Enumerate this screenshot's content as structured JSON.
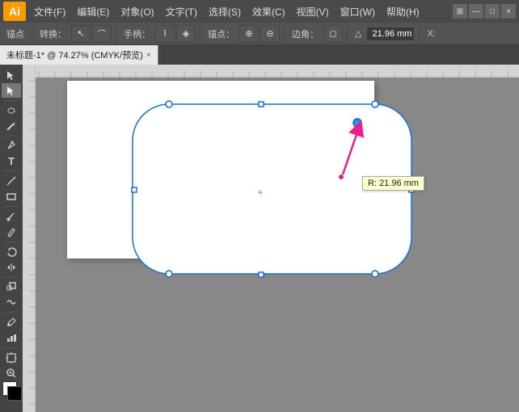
{
  "titlebar": {
    "logo": "Ai",
    "menus": [
      "文件(F)",
      "编辑(E)",
      "对象(O)",
      "文字(T)",
      "选择(S)",
      "效果(C)",
      "视图(V)",
      "窗口(W)",
      "帮助(H)"
    ],
    "win_controls": [
      "□",
      "—",
      "×"
    ]
  },
  "toolbar1": {
    "label1": "锚点",
    "label2": "转换：",
    "label3": "手柄：",
    "label4": "锚点：",
    "label5": "边角：",
    "angle_label": "△",
    "angle_value": "21.96 mm",
    "x_label": "X:",
    "grid_icon": "⊞"
  },
  "tabs": [
    {
      "label": "未标题-1* @ 74.27% (CMYK/预览)",
      "active": true
    }
  ],
  "tools": [
    {
      "icon": "↖",
      "name": "select"
    },
    {
      "icon": "⊹",
      "name": "direct-select"
    },
    {
      "icon": "⬡",
      "name": "lasso"
    },
    {
      "icon": "✒",
      "name": "pen"
    },
    {
      "icon": "T",
      "name": "type"
    },
    {
      "icon": "∕",
      "name": "line"
    },
    {
      "icon": "□",
      "name": "rectangle"
    },
    {
      "icon": "◉",
      "name": "paintbrush"
    },
    {
      "icon": "✏",
      "name": "pencil"
    },
    {
      "icon": "◈",
      "name": "rotate"
    },
    {
      "icon": "⟲",
      "name": "mirror"
    },
    {
      "icon": "◱",
      "name": "scale"
    },
    {
      "icon": "≋",
      "name": "warp"
    },
    {
      "icon": "⬛",
      "name": "width"
    },
    {
      "icon": "⊡",
      "name": "symbol-spray"
    },
    {
      "icon": "📊",
      "name": "graph"
    },
    {
      "icon": "✋",
      "name": "artboard"
    },
    {
      "icon": "🔍",
      "name": "zoom"
    }
  ],
  "canvas": {
    "tooltip": {
      "label": "R:",
      "value": "21.96 mm"
    },
    "shape": {
      "border_radius": "40px",
      "stroke_color": "#1a6fcc",
      "fill_color": "white"
    }
  },
  "colors": {
    "fill": "white",
    "stroke": "black"
  }
}
